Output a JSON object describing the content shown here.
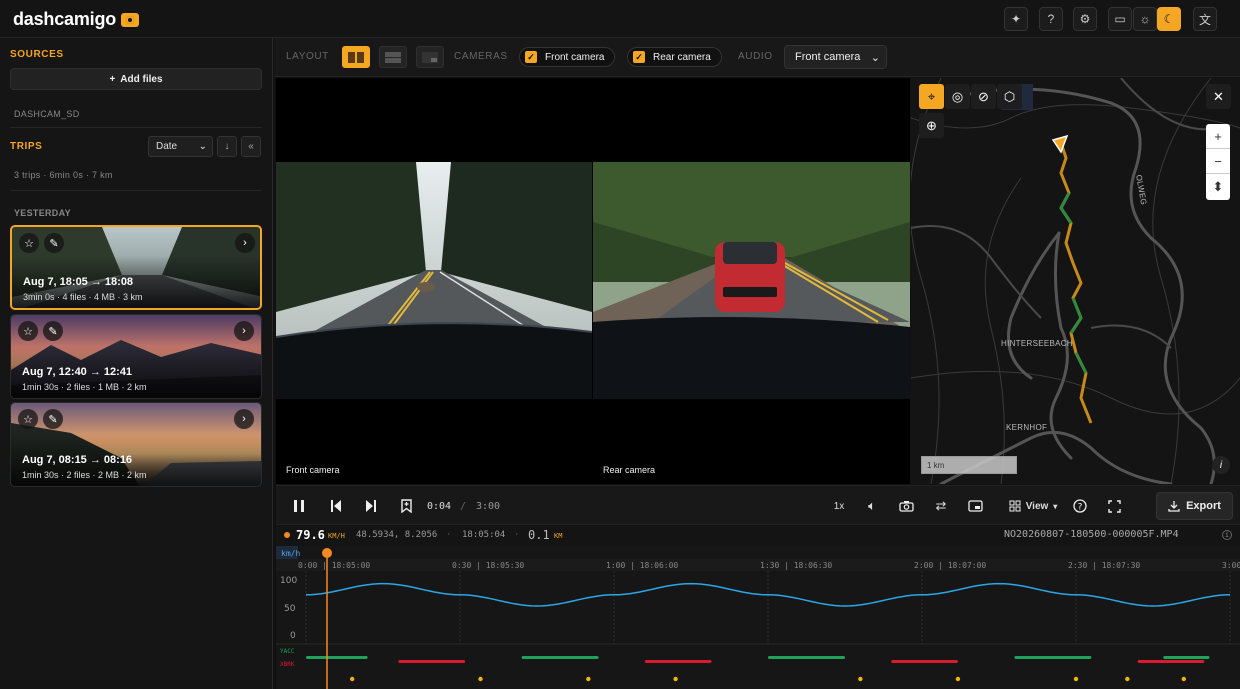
{
  "header": {
    "logo": "dashcamigo",
    "icons": [
      "sparkle-icon",
      "help-chat-icon",
      "gear-icon",
      "monitor-icon",
      "sun-icon",
      "moon-icon",
      "translate-icon"
    ]
  },
  "sidebar": {
    "sources_title": "SOURCES",
    "add_files": "Add files",
    "source_name": "DASHCAM_SD",
    "trips_title": "TRIPS",
    "sort": "Date",
    "summary": "3 trips · 6min 0s · 7 km",
    "group_label": "YESTERDAY",
    "trips": [
      {
        "title": "Aug 7, 18:05 → 18:08",
        "meta": "3min 0s · 4 files · 4 MB · 3 km"
      },
      {
        "title": "Aug 7, 12:40 → 12:41",
        "meta": "1min 30s · 2 files · 1 MB · 2 km"
      },
      {
        "title": "Aug 7, 08:15 → 08:16",
        "meta": "1min 30s · 2 files · 2 MB · 2 km"
      }
    ]
  },
  "toolbar": {
    "layout_label": "LAYOUT",
    "cameras_label": "CAMERAS",
    "front_camera": "Front camera",
    "rear_camera": "Rear camera",
    "audio_label": "AUDIO",
    "audio_value": "Front camera"
  },
  "video": {
    "front_label": "Front camera",
    "rear_label": "Rear camera"
  },
  "map": {
    "labels": [
      "OLWEG",
      "HINTERSEEBACH",
      "KERNHOF"
    ],
    "scale": "1 km",
    "info": "i"
  },
  "controls": {
    "time_current": "0:04",
    "time_sep": "/",
    "time_total": "3:00",
    "speed": "1x",
    "view": "View",
    "export": "Export"
  },
  "status": {
    "speed": "79.6",
    "speed_unit": "KM/H",
    "coords": "48.5934, 8.2056",
    "clock": "18:05:04",
    "distance": "0.1",
    "distance_unit": "KM",
    "filename": "NO20260807-180500-000005F.MP4"
  },
  "timeline": {
    "unit": "km/h",
    "ticks": [
      "0:00 | 18:05:00",
      "0:30 | 18:05:30",
      "1:00 | 18:06:00",
      "1:30 | 18:06:30",
      "2:00 | 18:07:00",
      "2:30 | 18:07:30",
      "3:00 | 18:08:00"
    ],
    "y_ticks": [
      "100",
      "50",
      "0"
    ],
    "track_labels": [
      "YACC",
      "XBRK"
    ]
  },
  "chart_data": {
    "type": "line",
    "ylim": [
      0,
      100
    ],
    "x": [
      0,
      15,
      30,
      45,
      60,
      75,
      90,
      105,
      120,
      135,
      150,
      165,
      180
    ],
    "series": [
      {
        "values": [
          70,
          90,
          70,
          50,
          70,
          90,
          70,
          50,
          70,
          90,
          70,
          50,
          70
        ]
      }
    ],
    "colors": {
      "speed": "#2aa7e8",
      "accel": "#1fa35a",
      "brake": "#d81b2e",
      "event": "#f5b800",
      "cursor": "#f58a1f"
    }
  }
}
